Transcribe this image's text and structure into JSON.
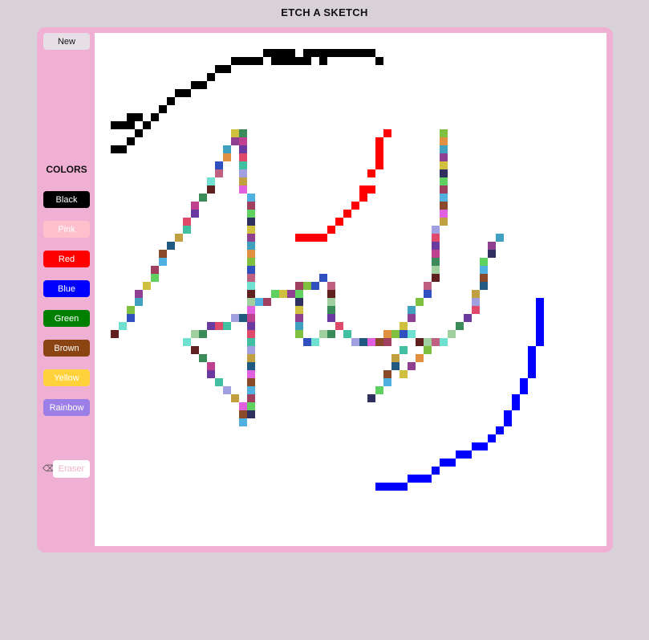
{
  "app": {
    "title": "ETCH A SKETCH"
  },
  "toolbar": {
    "new_label": "New",
    "colors_heading": "COLORS",
    "eraser_label": "Eraser"
  },
  "colors": [
    {
      "label": "Black",
      "bg": "#000000",
      "fg": "#ffffff"
    },
    {
      "label": "Pink",
      "bg": "#ffc0cb",
      "fg": "#ffffff"
    },
    {
      "label": "Red",
      "bg": "#ff0000",
      "fg": "#ffffff"
    },
    {
      "label": "Blue",
      "bg": "#0000ff",
      "fg": "#ffffff"
    },
    {
      "label": "Green",
      "bg": "#008000",
      "fg": "#ffffff"
    },
    {
      "label": "Brown",
      "bg": "#8b4513",
      "fg": "#ffffff"
    },
    {
      "label": "Yellow",
      "bg": "#ffd23c",
      "fg": "#ffffff"
    },
    {
      "label": "Rainbow",
      "bg": "#9b7fe6",
      "fg": "#ffffff"
    }
  ],
  "theme": {
    "frame": "#f0b0d4",
    "background": "#d8d2d8",
    "canvas": "#ffffff"
  },
  "icons": {
    "eraser": "eraser-icon"
  }
}
